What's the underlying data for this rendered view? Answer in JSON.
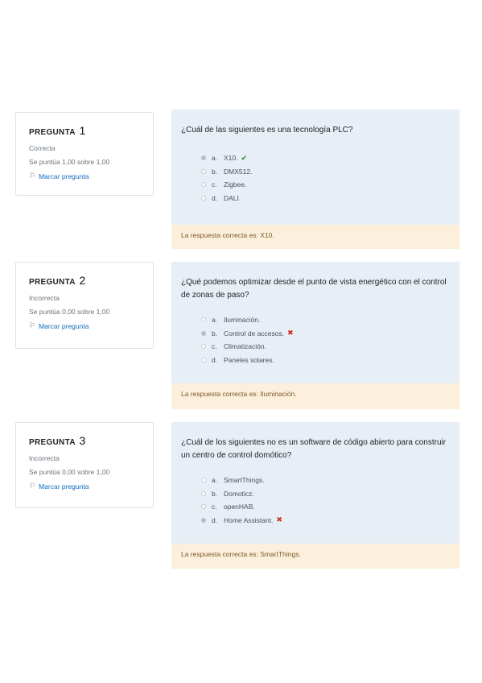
{
  "questions": [
    {
      "label": "PREGUNTA",
      "number": "1",
      "state": "Correcta",
      "grade": "Se puntúa 1,00 sobre 1,00",
      "flag_label": "Marcar pregunta",
      "text": "¿Cuál de las siguientes es una tecnología PLC?",
      "options": [
        {
          "letter": "a.",
          "text": "X10.",
          "selected": true,
          "mark": "correct"
        },
        {
          "letter": "b.",
          "text": "DMX512.",
          "selected": false,
          "mark": ""
        },
        {
          "letter": "c.",
          "text": "Zigbee.",
          "selected": false,
          "mark": ""
        },
        {
          "letter": "d.",
          "text": "DALI.",
          "selected": false,
          "mark": ""
        }
      ],
      "feedback": "La respuesta correcta es: X10."
    },
    {
      "label": "PREGUNTA",
      "number": "2",
      "state": "Incorrecta",
      "grade": "Se puntúa 0,00 sobre 1,00",
      "flag_label": "Marcar pregunta",
      "text": "¿Qué podemos optimizar desde el punto de vista energético con el control de zonas de paso?",
      "options": [
        {
          "letter": "a.",
          "text": "Iluminación.",
          "selected": false,
          "mark": ""
        },
        {
          "letter": "b.",
          "text": "Control de accesos.",
          "selected": true,
          "mark": "incorrect"
        },
        {
          "letter": "c.",
          "text": "Climatización.",
          "selected": false,
          "mark": ""
        },
        {
          "letter": "d.",
          "text": "Paneles solares.",
          "selected": false,
          "mark": ""
        }
      ],
      "feedback": "La respuesta correcta es: Iluminación."
    },
    {
      "label": "PREGUNTA",
      "number": "3",
      "state": "Incorrecta",
      "grade": "Se puntúa 0,00 sobre 1,00",
      "flag_label": "Marcar pregunta",
      "text": "¿Cuál de los siguientes no es un software de código abierto para construir un centro de control domótico?",
      "options": [
        {
          "letter": "a.",
          "text": "SmartThings.",
          "selected": false,
          "mark": ""
        },
        {
          "letter": "b.",
          "text": "Domoticz.",
          "selected": false,
          "mark": ""
        },
        {
          "letter": "c.",
          "text": "openHAB.",
          "selected": false,
          "mark": ""
        },
        {
          "letter": "d.",
          "text": "Home Assistant.",
          "selected": true,
          "mark": "incorrect"
        }
      ],
      "feedback": "La respuesta correcta es: SmartThings."
    }
  ],
  "icons": {
    "flag": "flag-icon",
    "correct": "check-icon",
    "incorrect": "cross-icon"
  },
  "colors": {
    "formulation_bg": "#e8eef5",
    "feedback_bg": "#fcefdc",
    "link": "#0f6cbf",
    "correct": "#357a32",
    "incorrect": "#ca3120"
  }
}
